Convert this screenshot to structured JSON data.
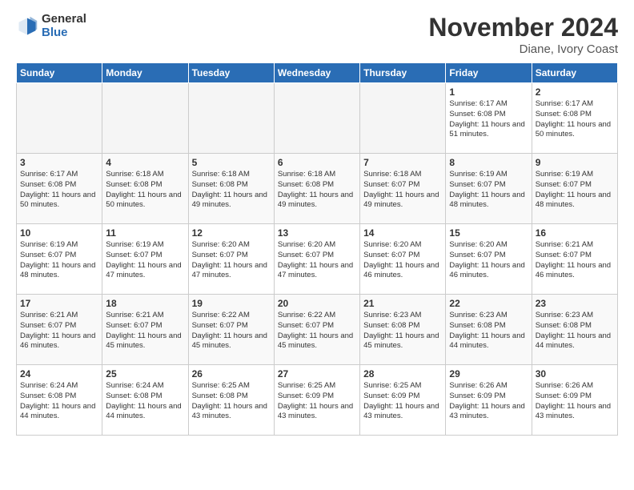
{
  "logo": {
    "general": "General",
    "blue": "Blue"
  },
  "title": "November 2024",
  "subtitle": "Diane, Ivory Coast",
  "days_of_week": [
    "Sunday",
    "Monday",
    "Tuesday",
    "Wednesday",
    "Thursday",
    "Friday",
    "Saturday"
  ],
  "weeks": [
    [
      {
        "day": "",
        "empty": true
      },
      {
        "day": "",
        "empty": true
      },
      {
        "day": "",
        "empty": true
      },
      {
        "day": "",
        "empty": true
      },
      {
        "day": "",
        "empty": true
      },
      {
        "day": "1",
        "sunrise": "6:17 AM",
        "sunset": "6:08 PM",
        "daylight": "11 hours and 51 minutes."
      },
      {
        "day": "2",
        "sunrise": "6:17 AM",
        "sunset": "6:08 PM",
        "daylight": "11 hours and 50 minutes."
      }
    ],
    [
      {
        "day": "3",
        "sunrise": "6:17 AM",
        "sunset": "6:08 PM",
        "daylight": "11 hours and 50 minutes."
      },
      {
        "day": "4",
        "sunrise": "6:18 AM",
        "sunset": "6:08 PM",
        "daylight": "11 hours and 50 minutes."
      },
      {
        "day": "5",
        "sunrise": "6:18 AM",
        "sunset": "6:08 PM",
        "daylight": "11 hours and 49 minutes."
      },
      {
        "day": "6",
        "sunrise": "6:18 AM",
        "sunset": "6:08 PM",
        "daylight": "11 hours and 49 minutes."
      },
      {
        "day": "7",
        "sunrise": "6:18 AM",
        "sunset": "6:07 PM",
        "daylight": "11 hours and 49 minutes."
      },
      {
        "day": "8",
        "sunrise": "6:19 AM",
        "sunset": "6:07 PM",
        "daylight": "11 hours and 48 minutes."
      },
      {
        "day": "9",
        "sunrise": "6:19 AM",
        "sunset": "6:07 PM",
        "daylight": "11 hours and 48 minutes."
      }
    ],
    [
      {
        "day": "10",
        "sunrise": "6:19 AM",
        "sunset": "6:07 PM",
        "daylight": "11 hours and 48 minutes."
      },
      {
        "day": "11",
        "sunrise": "6:19 AM",
        "sunset": "6:07 PM",
        "daylight": "11 hours and 47 minutes."
      },
      {
        "day": "12",
        "sunrise": "6:20 AM",
        "sunset": "6:07 PM",
        "daylight": "11 hours and 47 minutes."
      },
      {
        "day": "13",
        "sunrise": "6:20 AM",
        "sunset": "6:07 PM",
        "daylight": "11 hours and 47 minutes."
      },
      {
        "day": "14",
        "sunrise": "6:20 AM",
        "sunset": "6:07 PM",
        "daylight": "11 hours and 46 minutes."
      },
      {
        "day": "15",
        "sunrise": "6:20 AM",
        "sunset": "6:07 PM",
        "daylight": "11 hours and 46 minutes."
      },
      {
        "day": "16",
        "sunrise": "6:21 AM",
        "sunset": "6:07 PM",
        "daylight": "11 hours and 46 minutes."
      }
    ],
    [
      {
        "day": "17",
        "sunrise": "6:21 AM",
        "sunset": "6:07 PM",
        "daylight": "11 hours and 46 minutes."
      },
      {
        "day": "18",
        "sunrise": "6:21 AM",
        "sunset": "6:07 PM",
        "daylight": "11 hours and 45 minutes."
      },
      {
        "day": "19",
        "sunrise": "6:22 AM",
        "sunset": "6:07 PM",
        "daylight": "11 hours and 45 minutes."
      },
      {
        "day": "20",
        "sunrise": "6:22 AM",
        "sunset": "6:07 PM",
        "daylight": "11 hours and 45 minutes."
      },
      {
        "day": "21",
        "sunrise": "6:23 AM",
        "sunset": "6:08 PM",
        "daylight": "11 hours and 45 minutes."
      },
      {
        "day": "22",
        "sunrise": "6:23 AM",
        "sunset": "6:08 PM",
        "daylight": "11 hours and 44 minutes."
      },
      {
        "day": "23",
        "sunrise": "6:23 AM",
        "sunset": "6:08 PM",
        "daylight": "11 hours and 44 minutes."
      }
    ],
    [
      {
        "day": "24",
        "sunrise": "6:24 AM",
        "sunset": "6:08 PM",
        "daylight": "11 hours and 44 minutes."
      },
      {
        "day": "25",
        "sunrise": "6:24 AM",
        "sunset": "6:08 PM",
        "daylight": "11 hours and 44 minutes."
      },
      {
        "day": "26",
        "sunrise": "6:25 AM",
        "sunset": "6:08 PM",
        "daylight": "11 hours and 43 minutes."
      },
      {
        "day": "27",
        "sunrise": "6:25 AM",
        "sunset": "6:09 PM",
        "daylight": "11 hours and 43 minutes."
      },
      {
        "day": "28",
        "sunrise": "6:25 AM",
        "sunset": "6:09 PM",
        "daylight": "11 hours and 43 minutes."
      },
      {
        "day": "29",
        "sunrise": "6:26 AM",
        "sunset": "6:09 PM",
        "daylight": "11 hours and 43 minutes."
      },
      {
        "day": "30",
        "sunrise": "6:26 AM",
        "sunset": "6:09 PM",
        "daylight": "11 hours and 43 minutes."
      }
    ]
  ]
}
